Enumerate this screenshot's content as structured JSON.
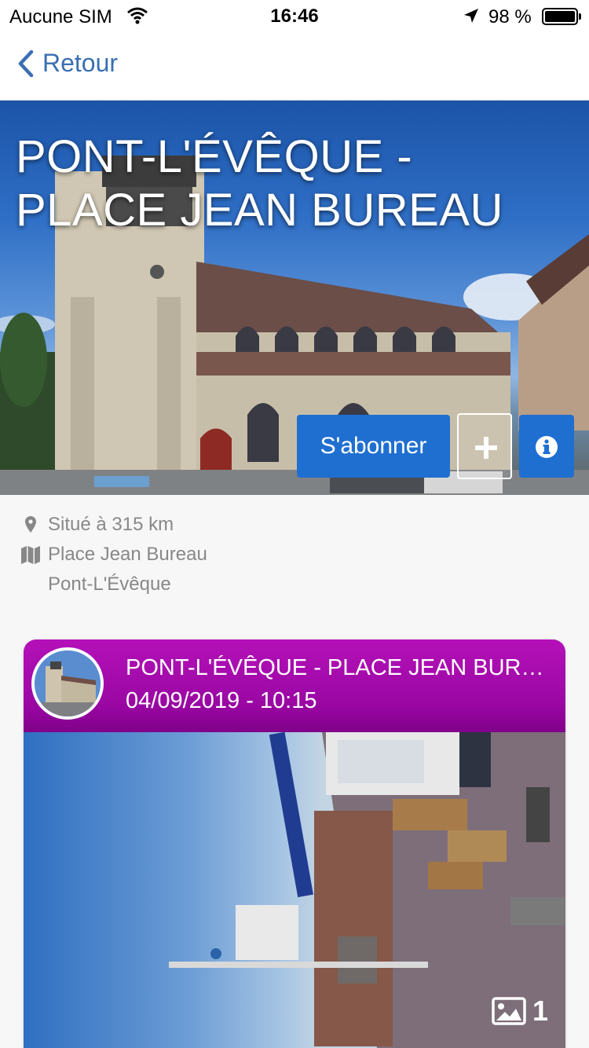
{
  "status_bar": {
    "carrier": "Aucune SIM",
    "time": "16:46",
    "battery": "98 %"
  },
  "nav": {
    "back_label": "Retour"
  },
  "hero": {
    "title": "PONT-L'ÉVÊQUE - PLACE JEAN BUREAU",
    "subscribe_label": "S'abonner",
    "plus_icon": "plus-icon",
    "info_icon": "info-icon"
  },
  "info": {
    "distance": "Situé à 315 km",
    "address_line1": "Place Jean Bureau",
    "address_line2": "Pont-L'Évêque"
  },
  "card": {
    "title": "PONT-L'ÉVÊQUE - PLACE JEAN BUREAU",
    "date": "04/09/2019 - 10:15",
    "photo_count": "1"
  },
  "colors": {
    "accent_blue": "#1f6fd1",
    "nav_blue": "#3a6fb3",
    "card_header_magenta": "#a00aa8"
  }
}
